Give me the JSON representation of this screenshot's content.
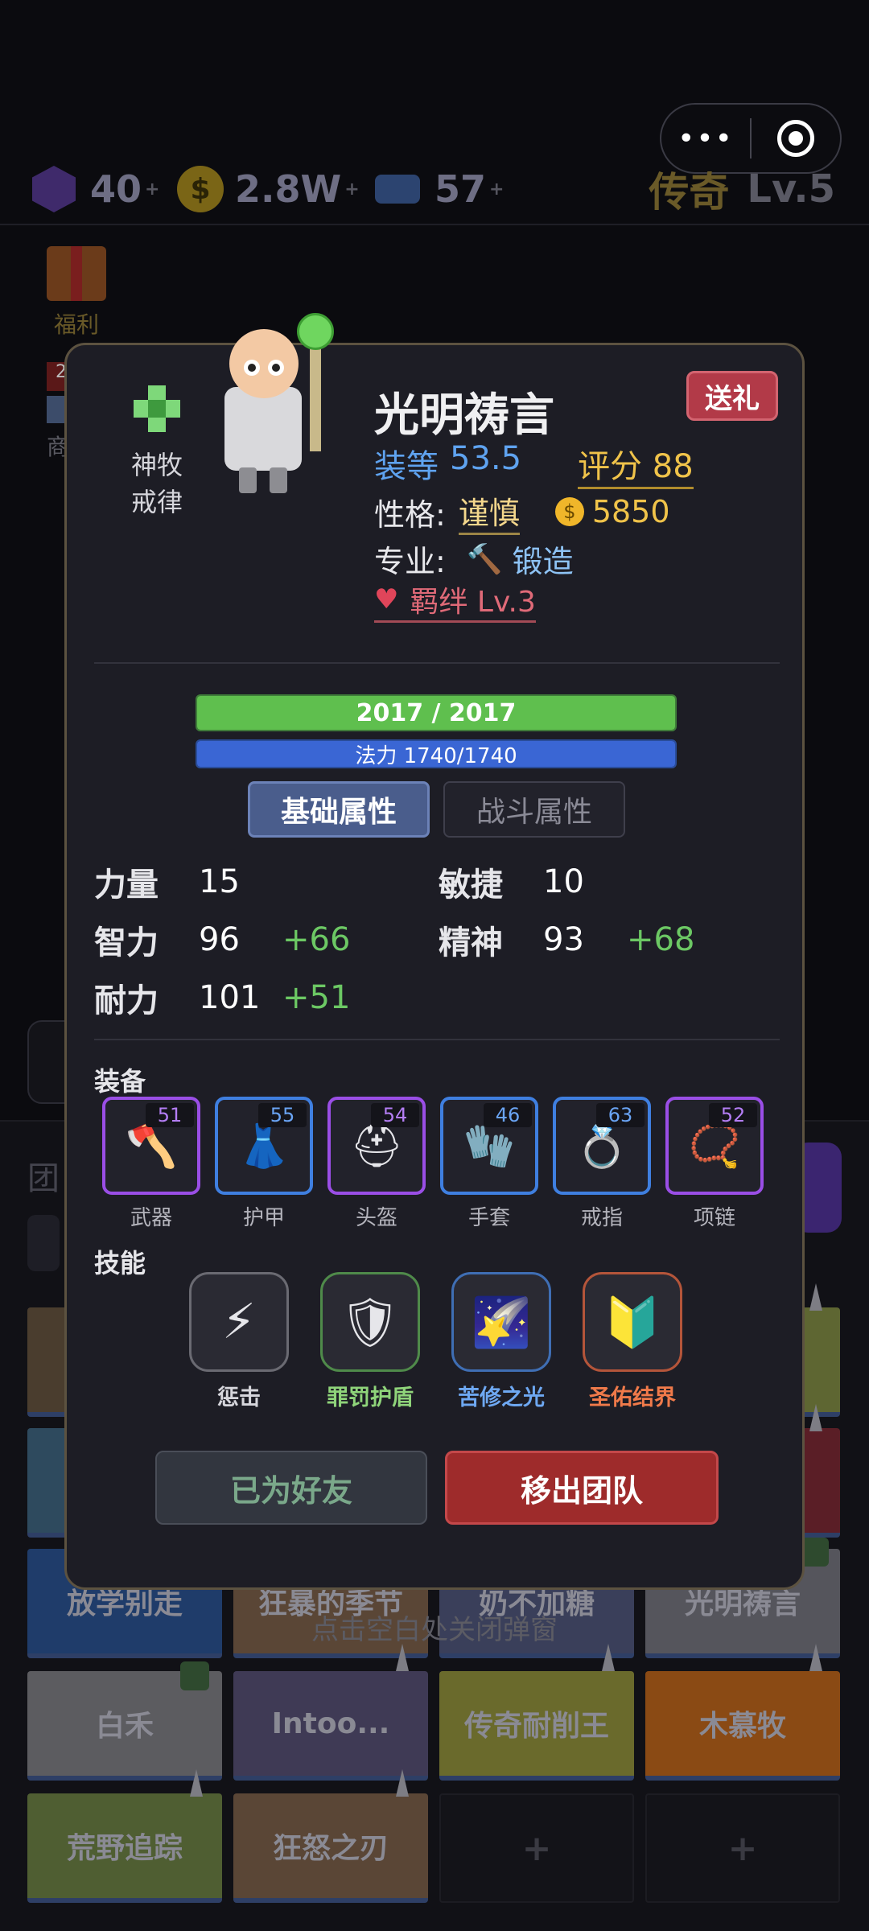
{
  "capsule": {
    "menu_glyph": "•••"
  },
  "resources": {
    "gems": "40",
    "gold": "2.8W",
    "tickets": "57",
    "plus": "+",
    "coin_glyph": "$"
  },
  "rank": {
    "title": "传奇",
    "level": "Lv.5"
  },
  "welfare_label": "福利",
  "shop": {
    "badge": "2",
    "label": "商"
  },
  "team_grid": {
    "cells": [
      {
        "name": "放学别走",
        "color": "#1f3c6a"
      },
      {
        "name": "狂暴的季节",
        "color": "#5a4636"
      },
      {
        "name": "奶不加糖",
        "color": "#3a3f5a"
      },
      {
        "name": "光明祷言",
        "color": "#55555c"
      },
      {
        "name": "白禾",
        "color": "#5c5c60"
      },
      {
        "name": "Intoo...",
        "color": "#3f3a55"
      },
      {
        "name": "传奇耐削王",
        "color": "#6a6a2c"
      },
      {
        "name": "木慕牧",
        "color": "#8a4a14"
      },
      {
        "name": "荒野追踪",
        "color": "#4f5e32"
      },
      {
        "name": "狂怒之刃",
        "color": "#5a4636"
      }
    ],
    "empty_glyph": "+"
  },
  "close_hint": "点击空白处关闭弹窗",
  "hero": {
    "class_name_line1": "神牧",
    "class_name_line2": "戒律",
    "name": "光明祷言",
    "gift_label": "送礼",
    "gear_label": "装等",
    "gear_value": "53.5",
    "score_label": "评分",
    "score_value": "88",
    "trait_label": "性格:",
    "trait_value": "谨慎",
    "coin_glyph": "$",
    "price": "5850",
    "profession_label": "专业:",
    "profession_icon": "hammer-icon",
    "profession_glyph": "🔨",
    "profession_value": "锻造",
    "bond_glyph": "♥",
    "bond": "羁绊 Lv.3",
    "hp_text": "2017 / 2017",
    "hp_fraction": 1.0,
    "mp_text": "法力 1740/1740",
    "mp_fraction": 1.0
  },
  "tabs": {
    "basic": "基础属性",
    "combat": "战斗属性"
  },
  "stats": {
    "str_label": "力量",
    "str_value": "15",
    "agi_label": "敏捷",
    "agi_value": "10",
    "int_label": "智力",
    "int_value": "96",
    "int_bonus": "+66",
    "spi_label": "精神",
    "spi_value": "93",
    "spi_bonus": "+68",
    "sta_label": "耐力",
    "sta_value": "101",
    "sta_bonus": "+51"
  },
  "equipment": {
    "title": "装备",
    "items": [
      {
        "label": "武器",
        "level": "51",
        "rarity": "purple",
        "icon": "axe-icon",
        "glyph": "🪓"
      },
      {
        "label": "护甲",
        "level": "55",
        "rarity": "blue",
        "icon": "robe-icon",
        "glyph": "👗"
      },
      {
        "label": "头盔",
        "level": "54",
        "rarity": "purple",
        "icon": "helmet-icon",
        "glyph": "⛑"
      },
      {
        "label": "手套",
        "level": "46",
        "rarity": "blue",
        "icon": "glove-icon",
        "glyph": "🧤"
      },
      {
        "label": "戒指",
        "level": "63",
        "rarity": "blue",
        "icon": "ring-icon",
        "glyph": "💍"
      },
      {
        "label": "项链",
        "level": "52",
        "rarity": "purple",
        "icon": "necklace-icon",
        "glyph": "📿"
      }
    ]
  },
  "skills": {
    "title": "技能",
    "items": [
      {
        "label": "惩击",
        "color": "#d6d6dc",
        "icon": "lightning-icon",
        "glyph": "⚡",
        "border": "#6a6a72"
      },
      {
        "label": "罪罚护盾",
        "color": "#8fd47a",
        "icon": "shield-icon",
        "glyph": "🛡",
        "border": "#4f8a4a"
      },
      {
        "label": "苦修之光",
        "color": "#6ea8f2",
        "icon": "shooting-star-icon",
        "glyph": "🌠",
        "border": "#3f6eb4"
      },
      {
        "label": "圣佑结界",
        "color": "#f07a4a",
        "icon": "beginner-mark-icon",
        "glyph": "🔰",
        "border": "#b4553a"
      }
    ]
  },
  "actions": {
    "friend": "已为好友",
    "remove": "移出团队"
  }
}
